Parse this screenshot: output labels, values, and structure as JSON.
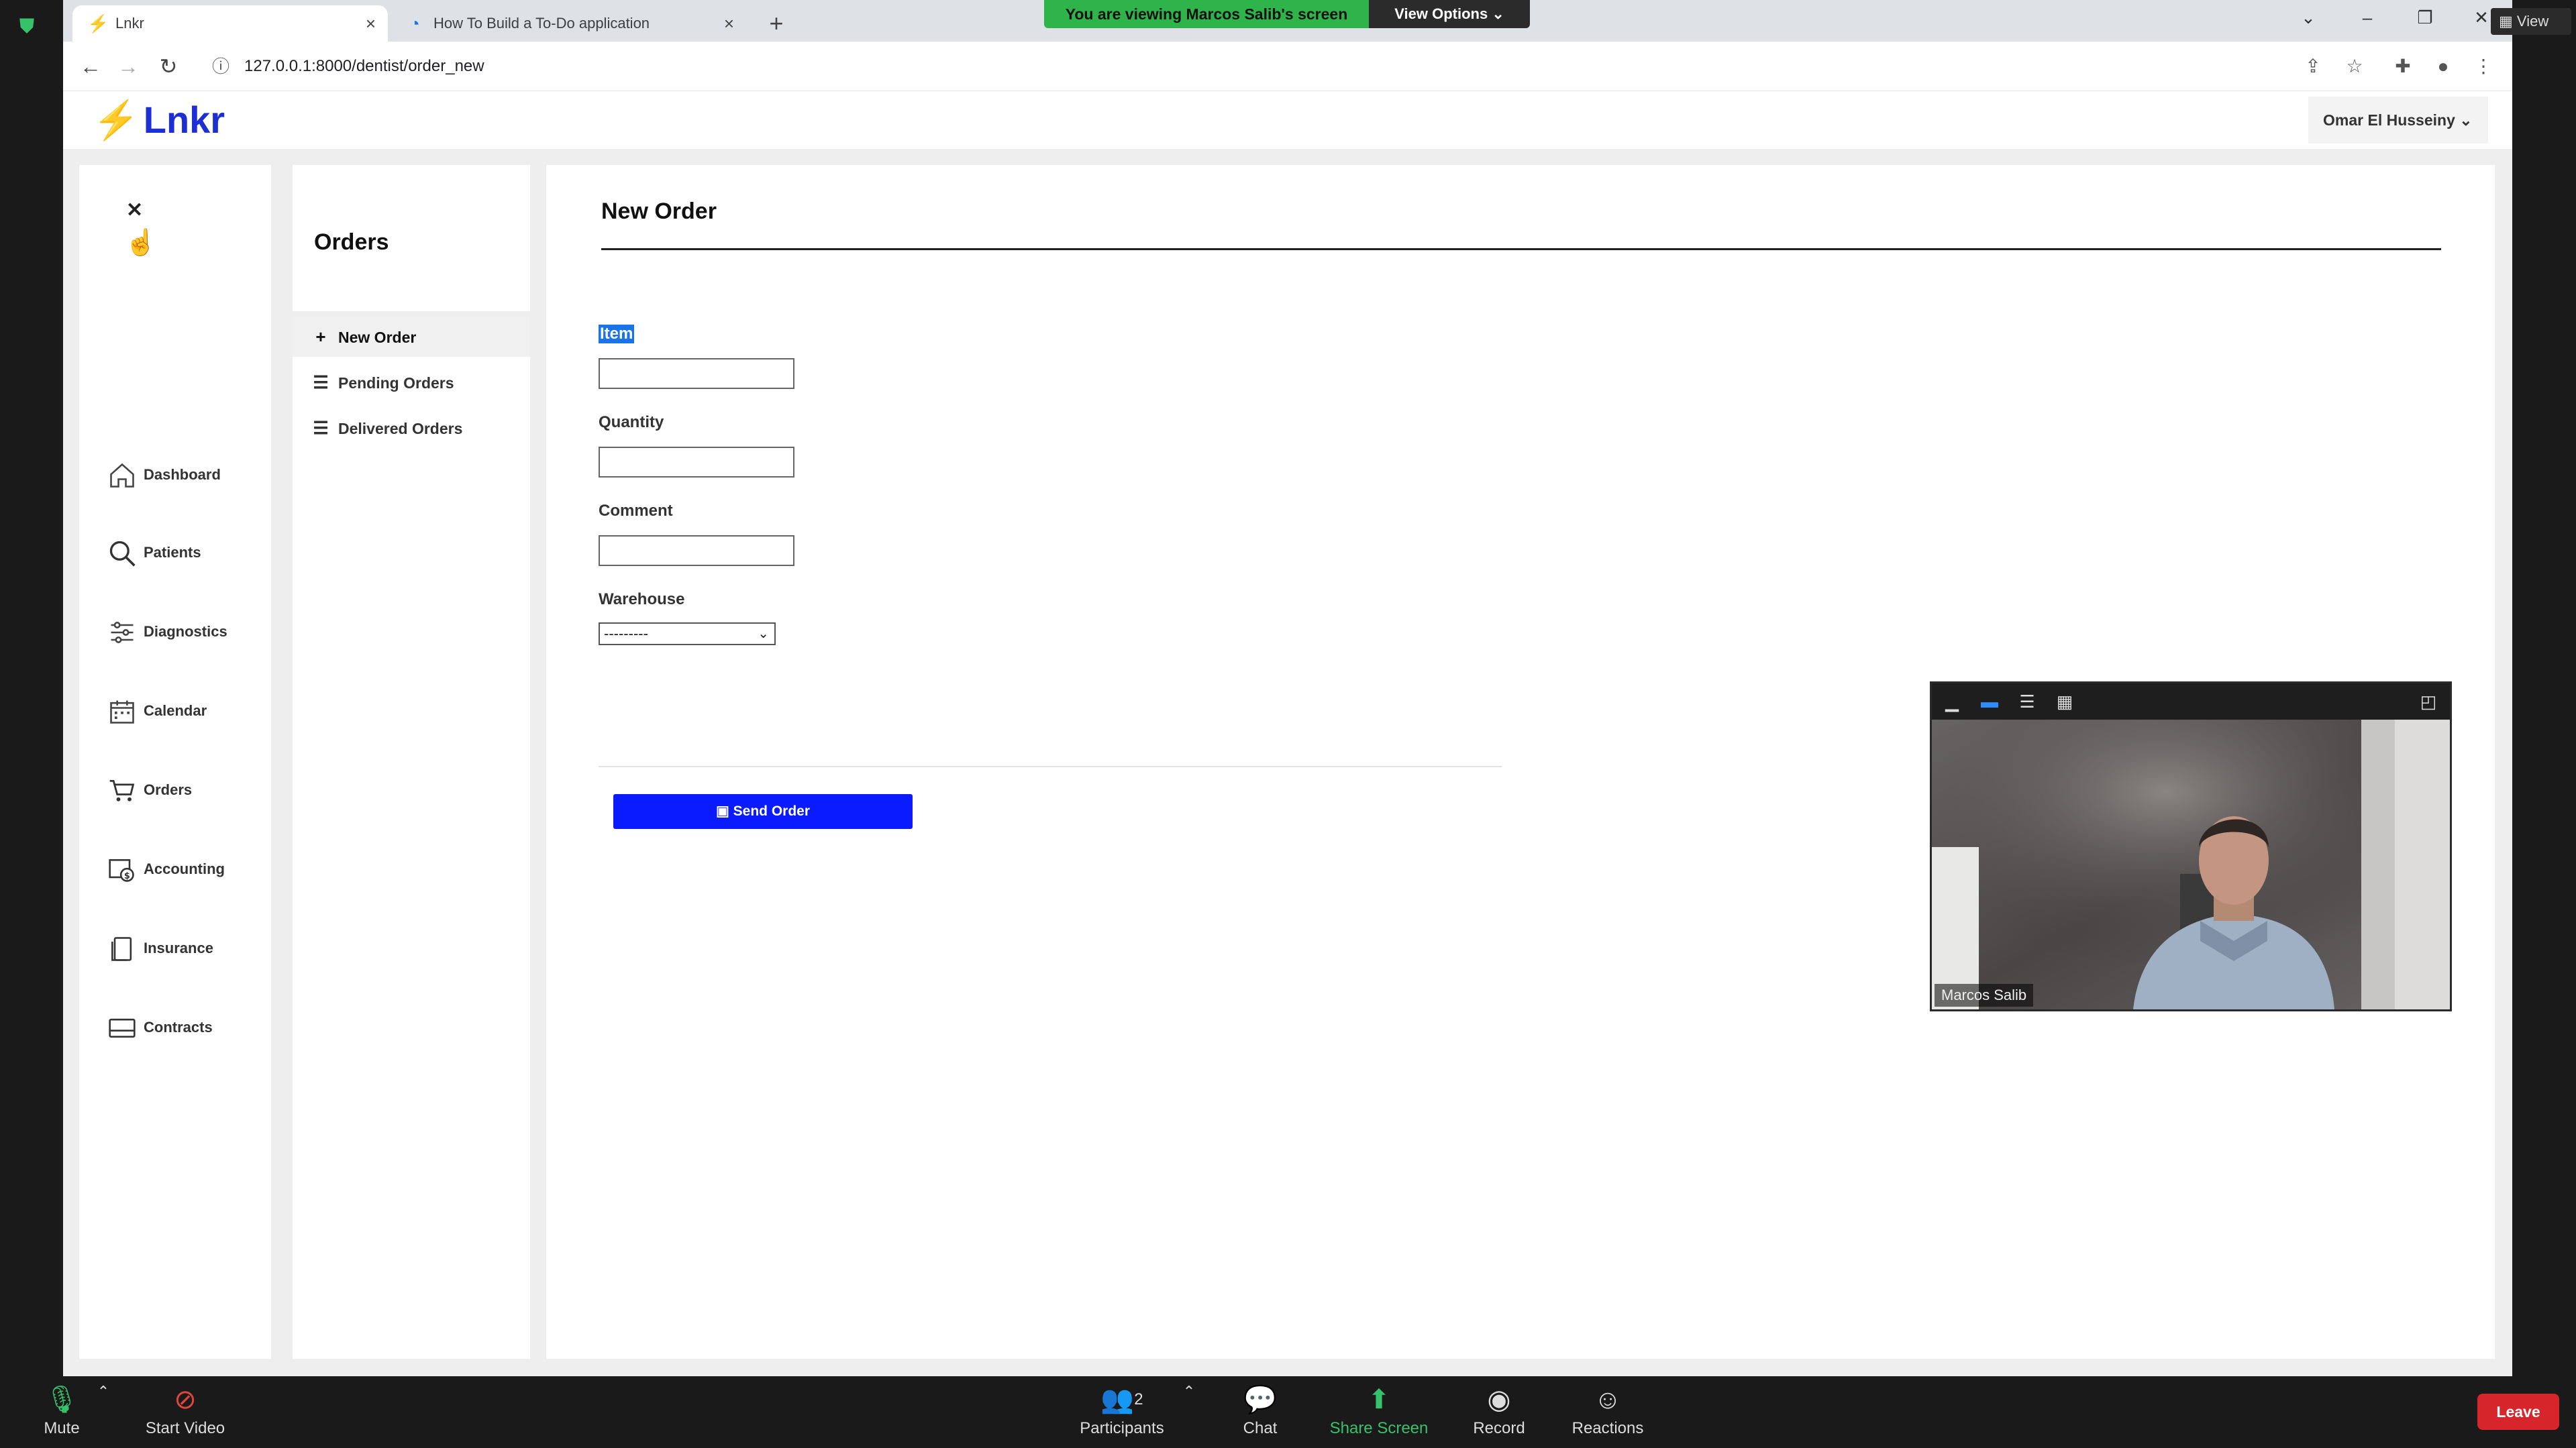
{
  "zoom": {
    "viewing_banner": "You are viewing Marcos Salib's screen",
    "view_options": "View Options ⌄",
    "view_label": "View",
    "bottom": {
      "mute": "Mute",
      "start_video": "Start Video",
      "participants": "Participants",
      "participants_count": "2",
      "chat": "Chat",
      "share_screen": "Share Screen",
      "record": "Record",
      "reactions": "Reactions",
      "leave": "Leave"
    },
    "video_name": "Marcos Salib"
  },
  "browser": {
    "tabs": [
      {
        "title": "Lnkr",
        "close": "×"
      },
      {
        "title": "How To Build a To-Do application",
        "close": "×"
      }
    ],
    "new_tab": "+",
    "url": "127.0.0.1:8000/dentist/order_new"
  },
  "app": {
    "logo": "Lnkr",
    "user": "Omar El Husseiny ⌄",
    "nav": [
      {
        "label": "Dashboard",
        "icon": "home-icon"
      },
      {
        "label": "Patients",
        "icon": "search-icon"
      },
      {
        "label": "Diagnostics",
        "icon": "sliders-icon"
      },
      {
        "label": "Calendar",
        "icon": "calendar-icon"
      },
      {
        "label": "Orders",
        "icon": "cart-icon"
      },
      {
        "label": "Accounting",
        "icon": "accounting-icon"
      },
      {
        "label": "Insurance",
        "icon": "document-icon"
      },
      {
        "label": "Contracts",
        "icon": "card-icon"
      }
    ],
    "subnav": {
      "title": "Orders",
      "items": [
        {
          "label": "New Order",
          "icon": "plus-icon"
        },
        {
          "label": "Pending Orders",
          "icon": "list-icon"
        },
        {
          "label": "Delivered Orders",
          "icon": "list-icon"
        }
      ]
    },
    "main": {
      "title": "New Order",
      "fields": {
        "item": "Item",
        "quantity": "Quantity",
        "comment": "Comment",
        "warehouse": "Warehouse",
        "warehouse_value": "---------"
      },
      "send_button": "Send Order"
    }
  }
}
